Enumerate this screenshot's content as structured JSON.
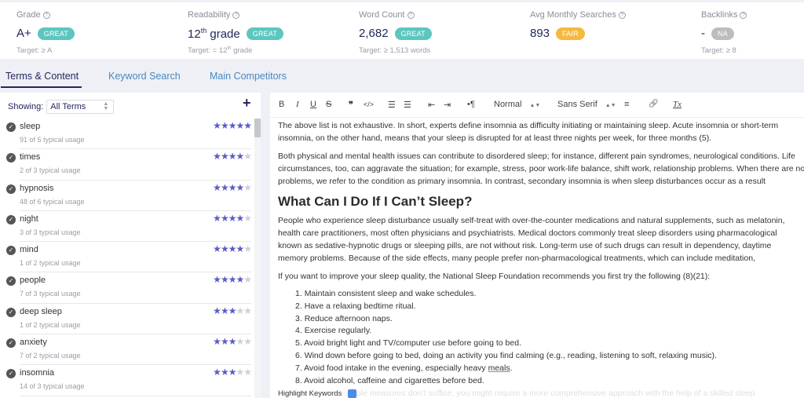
{
  "metrics": [
    {
      "label": "Grade",
      "value": "A+",
      "value_sup": "",
      "value_rest": "",
      "badge": "GREAT",
      "badge_type": "great",
      "target": "Target: ≥ A",
      "target_sup": "",
      "target_rest": ""
    },
    {
      "label": "Readability",
      "value": "12",
      "value_sup": "th",
      "value_rest": " grade",
      "badge": "GREAT",
      "badge_type": "great",
      "target": "Target: = 12",
      "target_sup": "th",
      "target_rest": " grade"
    },
    {
      "label": "Word Count",
      "value": "2,682",
      "value_sup": "",
      "value_rest": "",
      "badge": "GREAT",
      "badge_type": "great",
      "target": "Target: ≥ 1,513 words",
      "target_sup": "",
      "target_rest": ""
    },
    {
      "label": "Avg Monthly Searches",
      "value": "893",
      "value_sup": "",
      "value_rest": "",
      "badge": "FAIR",
      "badge_type": "fair",
      "target": "",
      "target_sup": "",
      "target_rest": ""
    },
    {
      "label": "Backlinks",
      "value": "-",
      "value_sup": "",
      "value_rest": "",
      "badge": "NA",
      "badge_type": "na",
      "target": "Target: ≥ 8",
      "target_sup": "",
      "target_rest": ""
    }
  ],
  "help_glyph": "?",
  "tabs": [
    {
      "label": "Terms & Content",
      "active": true
    },
    {
      "label": "Keyword Search",
      "active": false
    },
    {
      "label": "Main Competitors",
      "active": false
    }
  ],
  "left_panel": {
    "showing_label": "Showing:",
    "filter_value": "All Terms",
    "add_glyph": "+",
    "terms": [
      {
        "name": "sleep",
        "usage": "91 of 5 typical usage",
        "rating": 5
      },
      {
        "name": "times",
        "usage": "2 of 3 typical usage",
        "rating": 4
      },
      {
        "name": "hypnosis",
        "usage": "48 of 6 typical usage",
        "rating": 4
      },
      {
        "name": "night",
        "usage": "3 of 3 typical usage",
        "rating": 4
      },
      {
        "name": "mind",
        "usage": "1 of 2 typical usage",
        "rating": 4
      },
      {
        "name": "people",
        "usage": "7 of 3 typical usage",
        "rating": 4
      },
      {
        "name": "deep sleep",
        "usage": "1 of 2 typical usage",
        "rating": 3
      },
      {
        "name": "anxiety",
        "usage": "7 of 2 typical usage",
        "rating": 3
      },
      {
        "name": "insomnia",
        "usage": "14 of 3 typical usage",
        "rating": 3
      }
    ]
  },
  "toolbar": {
    "bold": "B",
    "italic": "I",
    "underline": "U",
    "strike": "S",
    "quote": "❞",
    "code": "</>",
    "ordered_list": "☰",
    "bullet_list": "☰",
    "outdent": "⇤",
    "indent": "⇥",
    "direction": "•¶",
    "heading_select": "Normal",
    "font_select": "Sans Serif",
    "align": "≡",
    "link": "🔗",
    "clear_format": "Tx"
  },
  "editor": {
    "paragraphs_top": [
      [
        "The above list is not exhaustive. In short, experts define insomnia as difficulty initiating or maintaining sleep. Acute insomnia or short-term",
        "insomnia, on the other hand, means that your sleep is disrupted for at least three nights per week, for three months (5)."
      ],
      [
        "Both physical and mental health issues can contribute to disordered sleep; for instance, different pain syndromes, neurological conditions. Life",
        "circumstances, too, can aggravate the situation; for example, stress, poor work-life balance, shift work, relationship problems. When there are no other",
        "problems, we refer to the condition as primary insomnia. In contrast, secondary insomnia is when sleep disturbances occur as a result"
      ]
    ],
    "heading": "What Can I Do If I Can’t Sleep?",
    "paragraph_people": [
      "People who experience sleep disturbance usually self-treat with over-the-counter medications and natural supplements, such as melatonin,",
      "health care practitioners, most often physicians and psychiatrists. Medical doctors commonly treat sleep disorders using pharmacological",
      "known as sedative-hypnotic drugs or sleeping pills, are not without risk. Long-term use of such drugs can result in dependency, daytime",
      "memory problems. Because of the side effects, many people prefer non-pharmacological treatments, which can include meditation,"
    ],
    "paragraph_intro": "If you want to improve your sleep quality, the National Sleep Foundation recommends you first try the following (8)(21):",
    "list": [
      "Maintain consistent sleep and wake schedules.",
      "Have a relaxing bedtime ritual.",
      "Reduce afternoon naps.",
      "Exercise regularly.",
      "Avoid bright light and TV/computer use before going to bed.",
      "Wind down before going to bed, doing an activity you find calming (e.g., reading, listening to soft, relaxing music).",
      "Avoid food intake in the evening, especially heavy ",
      "Avoid alcohol, caffeine and cigarettes before bed."
    ],
    "list_item7_underlined": "meals",
    "list_item7_end": ".",
    "faded_paragraph": "However, if those simple measures don’t suffice, you might require a more comprehensive approach with the help of a skilled sleep",
    "highlight_label": "Highlight Keywords"
  },
  "colors": {
    "great": "#5cc6bf",
    "fair": "#f5b942",
    "na": "#bdbdbd",
    "star_on": "#5a5cc8",
    "star_off": "#cfd0d5",
    "navy": "#23265e",
    "tab_link": "#4a87c0",
    "toggle": "#4a8de8"
  }
}
